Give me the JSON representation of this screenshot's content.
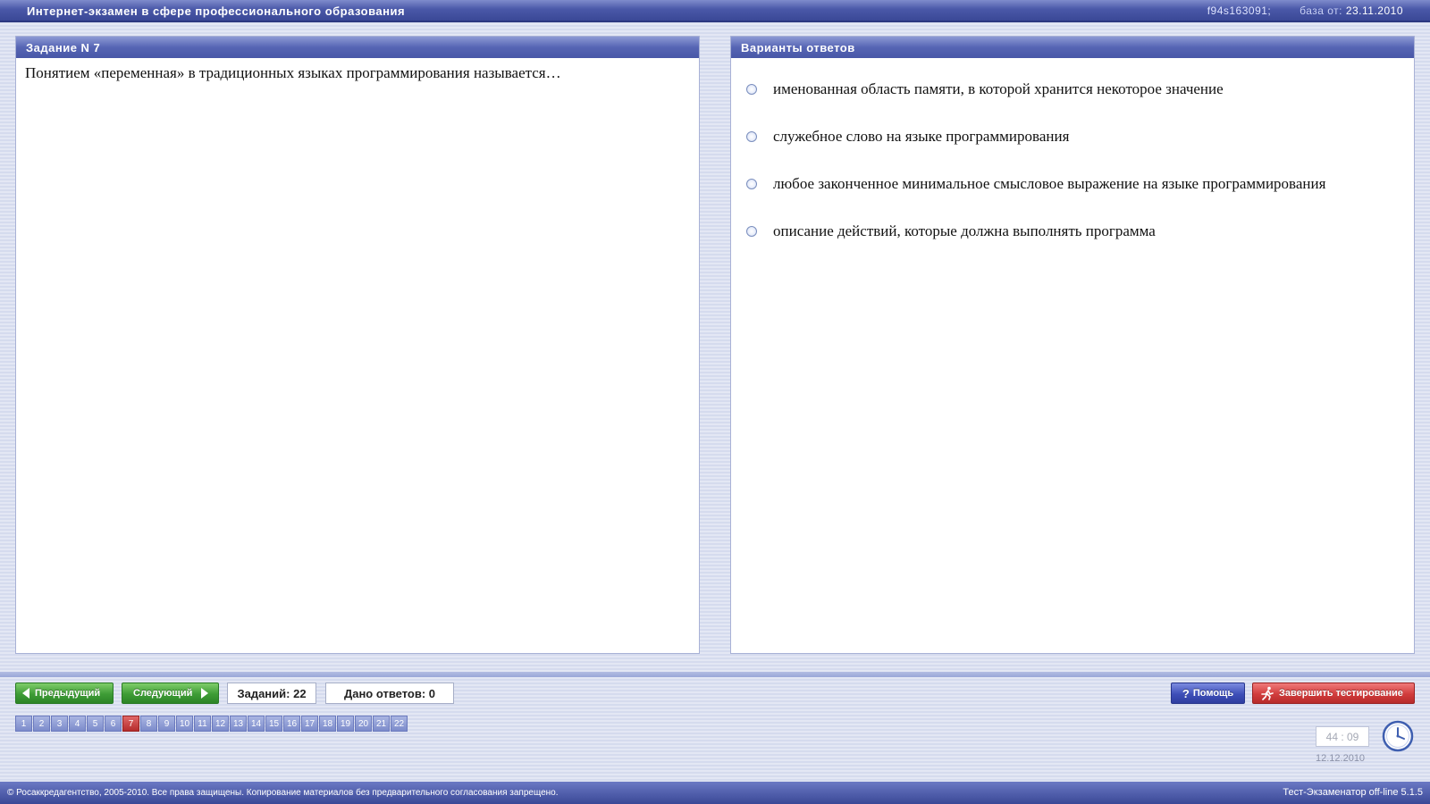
{
  "header": {
    "title": "Интернет-экзамен в сфере профессионального образования",
    "session_id": "f94s163091;",
    "base_label": "база от:",
    "base_date": "23.11.2010"
  },
  "question": {
    "header": "Задание N 7",
    "text": "Понятием «переменная» в традиционных языках программирования называется…"
  },
  "answers": {
    "header": "Варианты ответов",
    "options": [
      "именованная область памяти, в которой хранится некоторое значение",
      "служебное слово на языке программирования",
      "любое законченное минимальное смысловое выражение на языке программирования",
      "описание действий, которые должна выполнять программа"
    ]
  },
  "nav": {
    "prev_label": "Предыдущий",
    "next_label": "Следующий",
    "tasks_label": "Заданий: 22",
    "answered_label": "Дано ответов: 0",
    "help_label": "Помощь",
    "finish_label": "Завершить тестирование",
    "task_numbers": [
      "1",
      "2",
      "3",
      "4",
      "5",
      "6",
      "7",
      "8",
      "9",
      "10",
      "11",
      "12",
      "13",
      "14",
      "15",
      "16",
      "17",
      "18",
      "19",
      "20",
      "21",
      "22"
    ],
    "current_task": "7"
  },
  "timer": {
    "value": "44 : 09",
    "date": "12.12.2010"
  },
  "footer": {
    "copyright": "© Росаккредагентство, 2005-2010. Все права защищены. Копирование материалов без предварительного согласования запрещено.",
    "version": "Тест-Экзаменатор off-line 5.1.5"
  },
  "colors": {
    "header_blue": "#4a58a8",
    "nav_green": "#3e9c36",
    "finish_red": "#d13c3c",
    "current_task_red": "#b52c2c"
  }
}
